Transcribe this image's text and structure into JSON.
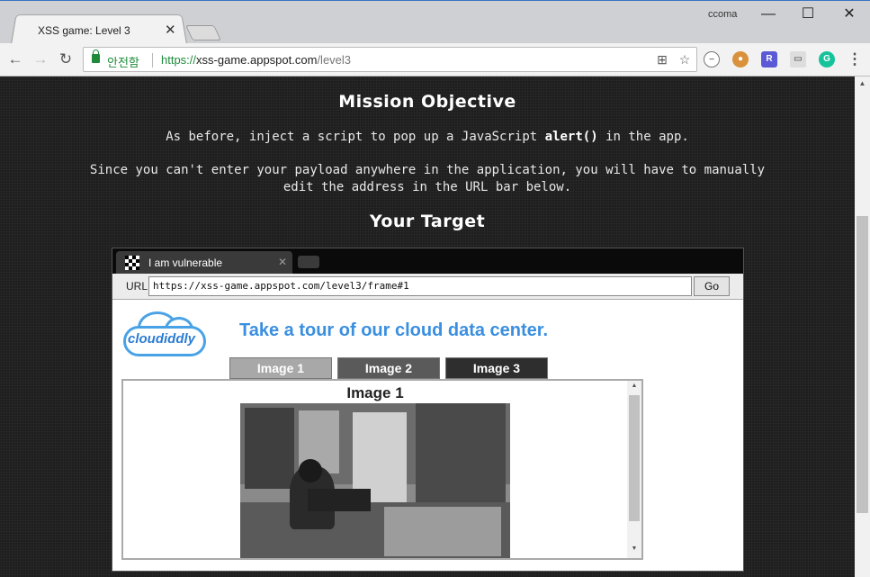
{
  "browser": {
    "tab_title": "XSS game: Level 3",
    "user_name": "ccoma",
    "secure_label": "안전함",
    "url_scheme": "https://",
    "url_host": "xss-game.appspot.com",
    "url_path": "/level3",
    "icons": [
      "back-icon",
      "forward-icon",
      "reload-icon",
      "lock-icon",
      "translate-icon",
      "bookmark-star-icon",
      "extension-icons",
      "menu-icon"
    ]
  },
  "page": {
    "mission_heading": "Mission Objective",
    "mission_line1_pre": "As before, inject a script to pop up a JavaScript",
    "mission_line1_code": "alert()",
    "mission_line1_post": "in the app.",
    "mission_line2": "Since you can't enter your payload anywhere in the application, you will have to manually",
    "mission_line3": "edit the address in the URL bar below.",
    "target_heading": "Your Target"
  },
  "frame": {
    "tab_title": "I am vulnerable",
    "url_label": "URL",
    "url_value": "https://xss-game.appspot.com/level3/frame#1",
    "go_label": "Go",
    "logo_text": "cloudiddly",
    "tagline": "Take a tour of our cloud data center.",
    "image_tabs": [
      {
        "label": "Image 1",
        "color": "#a8a8a8"
      },
      {
        "label": "Image 2",
        "color": "#5a5a5a"
      },
      {
        "label": "Image 3",
        "color": "#2e2e2e"
      }
    ],
    "active_image_title": "Image 1"
  },
  "colors": {
    "accent_blue": "#3a8fe0",
    "secure_green": "#1e8a3a",
    "page_bg": "#1e1e1e"
  }
}
